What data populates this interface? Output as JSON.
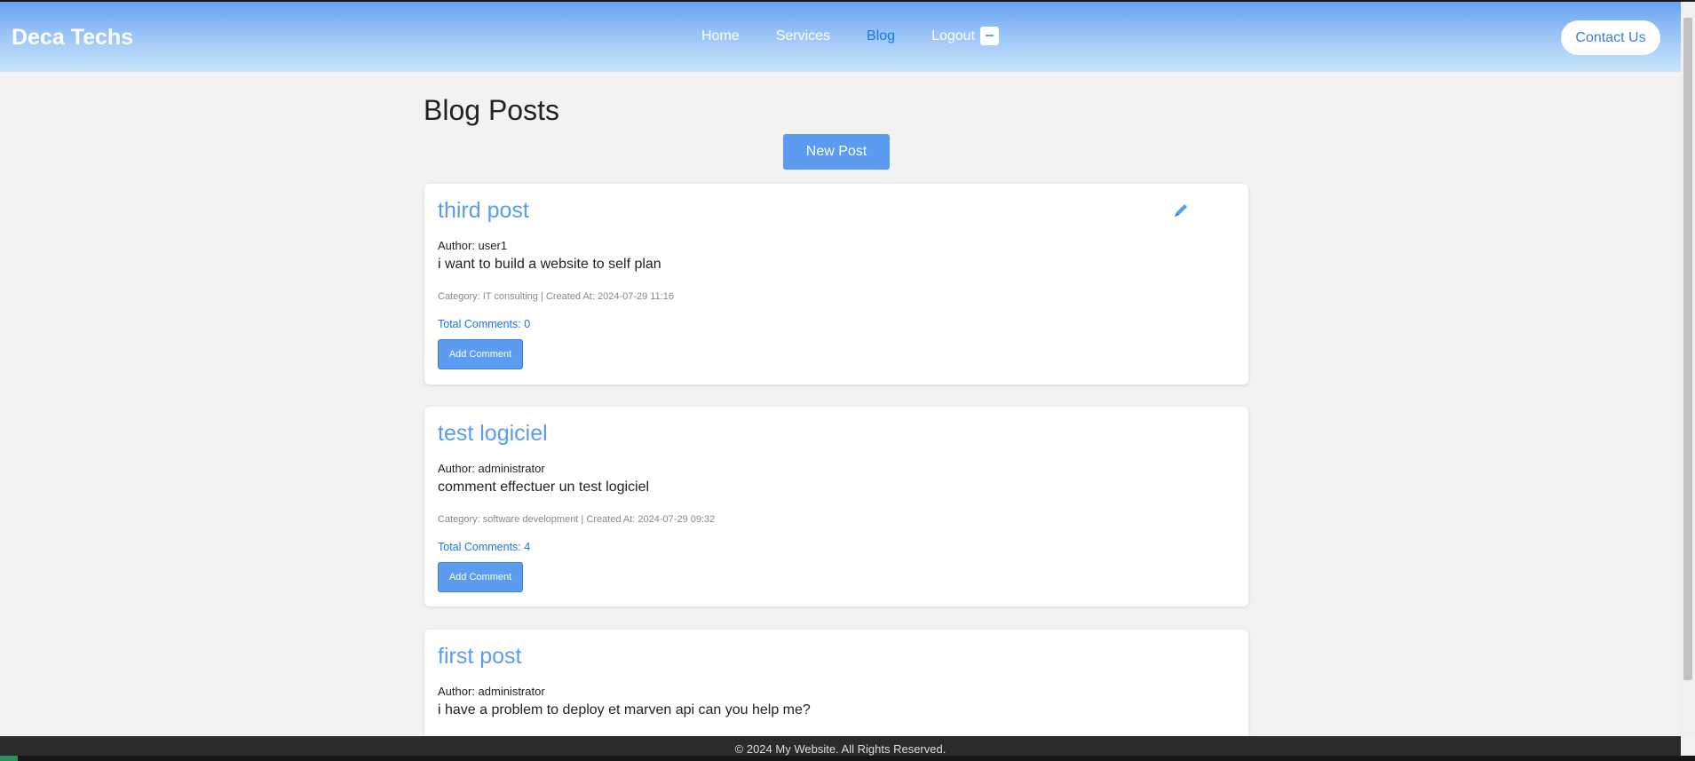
{
  "header": {
    "brand": "Deca Techs",
    "nav": [
      "Home",
      "Services",
      "Blog",
      "Logout"
    ],
    "active_nav": "Blog",
    "contact_label": "Contact Us"
  },
  "main": {
    "title": "Blog Posts",
    "new_post_label": "New Post",
    "posts": [
      {
        "title": "third post",
        "author": "Author: user1",
        "body": "i want to build a website to self plan",
        "meta": "Category: IT consulting | Created At: 2024-07-29 11:16",
        "comments": "Total Comments: 0",
        "add_comment_label": "Add Comment",
        "editable": true
      },
      {
        "title": "test logiciel",
        "author": "Author: administrator",
        "body": "comment effectuer un test logiciel",
        "meta": "Category: software development | Created At: 2024-07-29 09:32",
        "comments": "Total Comments: 4",
        "add_comment_label": "Add Comment",
        "editable": false
      },
      {
        "title": "first post",
        "author": "Author: administrator",
        "body": "i have a problem to deploy et marven api can you help me?",
        "editable": false
      }
    ]
  },
  "footer": {
    "text": "© 2024 My Website. All Rights Reserved."
  },
  "colors": {
    "accent": "#5b9cf0",
    "link_active": "#1a73e8",
    "background": "#f2f2f2"
  }
}
